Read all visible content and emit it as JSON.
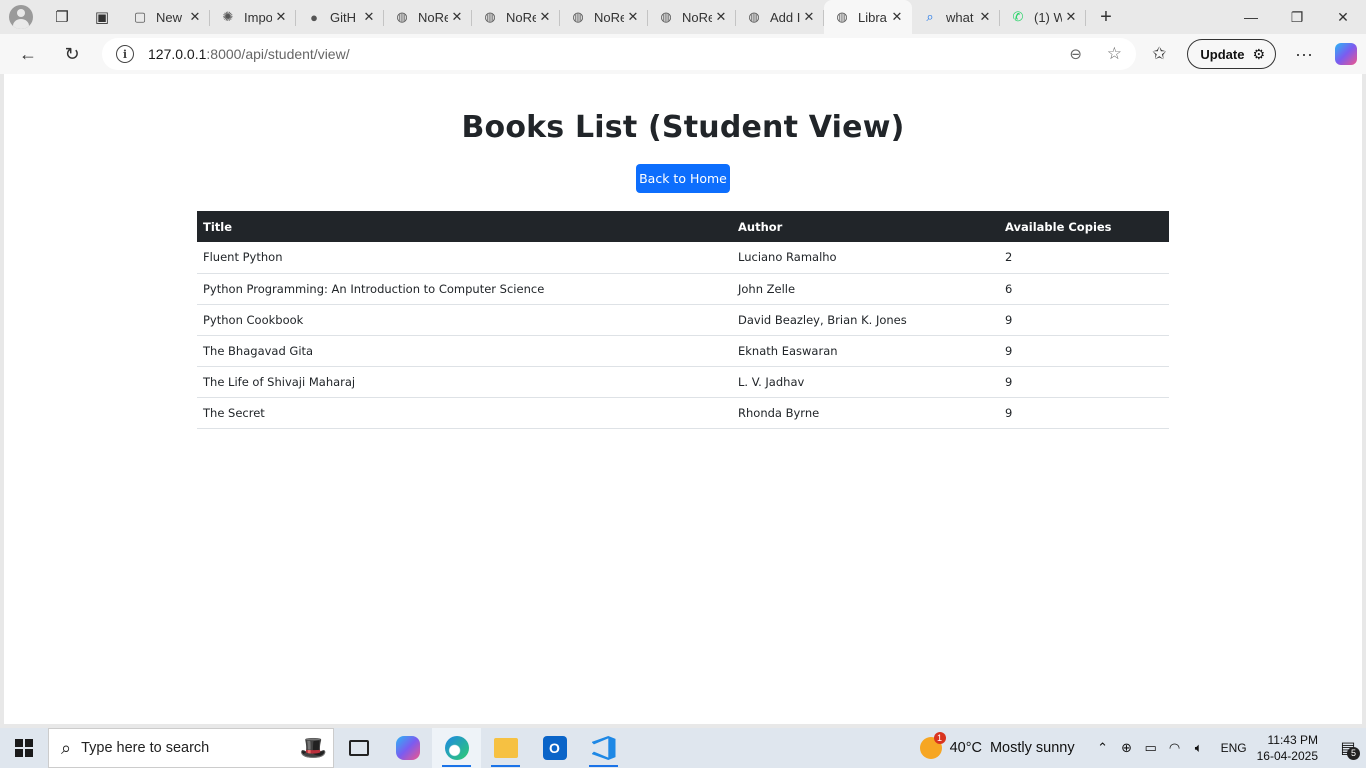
{
  "browser": {
    "tabs": [
      {
        "label": "New",
        "icon": "page-icon"
      },
      {
        "label": "Impo",
        "icon": "chatgpt-icon"
      },
      {
        "label": "GitH",
        "icon": "github-icon"
      },
      {
        "label": "NoRe",
        "icon": "globe-icon"
      },
      {
        "label": "NoRe",
        "icon": "globe-icon"
      },
      {
        "label": "NoRe",
        "icon": "globe-icon"
      },
      {
        "label": "NoRe",
        "icon": "globe-icon"
      },
      {
        "label": "Add I",
        "icon": "globe-icon"
      },
      {
        "label": "Libra",
        "icon": "globe-icon",
        "active": true
      },
      {
        "label": "what",
        "icon": "search-icon"
      },
      {
        "label": "(1) W",
        "icon": "whatsapp-icon"
      }
    ],
    "url_host": "127.0.0.1",
    "url_rest": ":8000/api/student/view/",
    "update_label": "Update"
  },
  "page": {
    "title": "Books List (Student View)",
    "back_button": "Back to Home",
    "table": {
      "headers": [
        "Title",
        "Author",
        "Available Copies"
      ],
      "rows": [
        [
          "Fluent Python",
          "Luciano Ramalho",
          "2"
        ],
        [
          "Python Programming: An Introduction to Computer Science",
          "John Zelle",
          "6"
        ],
        [
          "Python Cookbook",
          "David Beazley, Brian K. Jones",
          "9"
        ],
        [
          "The Bhagavad Gita",
          "Eknath Easwaran",
          "9"
        ],
        [
          "The Life of Shivaji Maharaj",
          "L. V. Jadhav",
          "9"
        ],
        [
          "The Secret",
          "Rhonda Byrne",
          "9"
        ]
      ]
    }
  },
  "taskbar": {
    "search_placeholder": "Type here to search",
    "weather_temp": "40°C",
    "weather_cond": "Mostly sunny",
    "lang": "ENG",
    "time": "11:43 PM",
    "date": "16-04-2025",
    "notif_count": "5"
  },
  "colors": {
    "primary_button": "#0d6efd",
    "table_header": "#212529"
  }
}
